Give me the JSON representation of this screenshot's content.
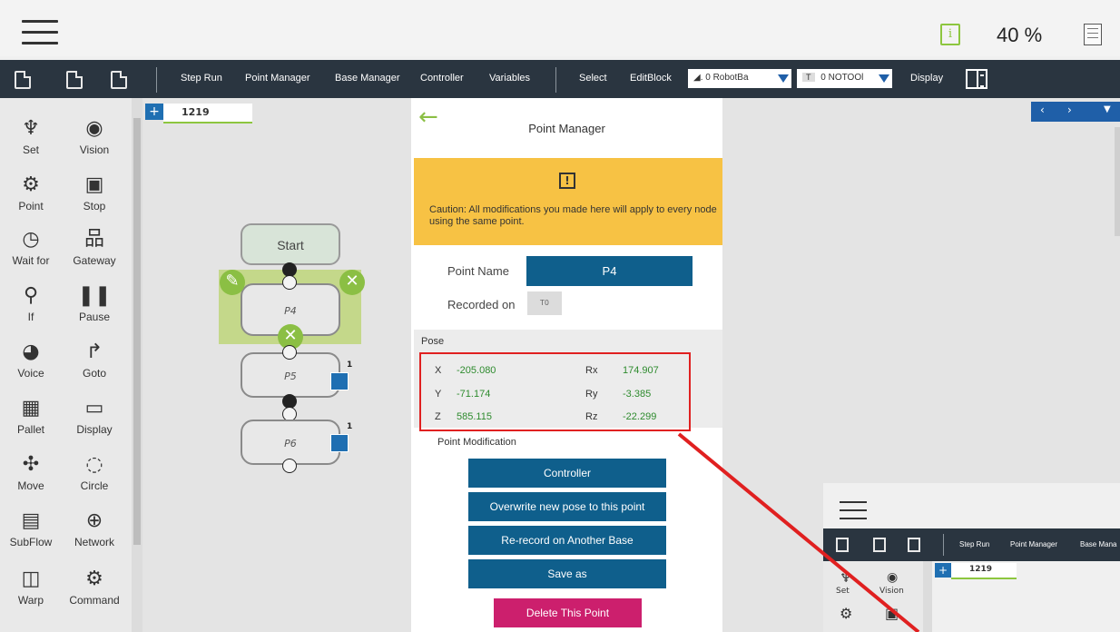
{
  "topbar": {
    "zoom": "40 %"
  },
  "toolbar": {
    "items": [
      "Step Run",
      "Point Manager",
      "Base Manager",
      "Controller",
      "Variables",
      "Select",
      "EditBlock",
      "Display"
    ],
    "base_select": "0 RobotBa",
    "tool_select": "0 NOTOOl",
    "tool_tag": "T"
  },
  "left_panel": [
    {
      "label": "Set",
      "icon": "wrench-icon"
    },
    {
      "label": "Vision",
      "icon": "eye-icon"
    },
    {
      "label": "Point",
      "icon": "robot-arm-icon"
    },
    {
      "label": "Stop",
      "icon": "stop-icon"
    },
    {
      "label": "Wait for",
      "icon": "clock-icon"
    },
    {
      "label": "Gateway",
      "icon": "gateway-icon"
    },
    {
      "label": "If",
      "icon": "branch-icon"
    },
    {
      "label": "Pause",
      "icon": "pause-icon"
    },
    {
      "label": "Voice",
      "icon": "voice-icon"
    },
    {
      "label": "Goto",
      "icon": "goto-arrow-icon"
    },
    {
      "label": "Pallet",
      "icon": "pallet-grid-icon"
    },
    {
      "label": "Display",
      "icon": "display-icon"
    },
    {
      "label": "Move",
      "icon": "move-icon"
    },
    {
      "label": "Circle",
      "icon": "circle-icon"
    },
    {
      "label": "SubFlow",
      "icon": "subflow-icon"
    },
    {
      "label": "Network",
      "icon": "globe-icon"
    },
    {
      "label": "Warp",
      "icon": "warp-icon"
    },
    {
      "label": "Command",
      "icon": "command-icon"
    }
  ],
  "flow": {
    "tab": "1219",
    "start": "Start",
    "nodes": [
      "P4",
      "P5",
      "P6"
    ],
    "badge_num": "1"
  },
  "point_manager": {
    "title": "Point Manager",
    "caution": "Caution: All modifications you made here will apply to every node using the same point.",
    "point_name_label": "Point Name",
    "point_name": "P4",
    "recorded_on_label": "Recorded on",
    "recorded_on": "T0",
    "pose_label": "Pose",
    "pose": {
      "x_label": "X",
      "x": "-205.080",
      "y_label": "Y",
      "y": "-71.174",
      "z_label": "Z",
      "z": "585.115",
      "rx_label": "Rx",
      "rx": "174.907",
      "ry_label": "Ry",
      "ry": "-3.385",
      "rz_label": "Rz",
      "rz": "-22.299"
    },
    "modification_label": "Point Modification",
    "buttons": [
      "Controller",
      "Overwrite new pose to this point",
      "Re-record on Another Base",
      "Save as"
    ],
    "delete": "Delete This Point"
  },
  "inset": {
    "items": [
      "Step Run",
      "Point Manager",
      "Base Mana"
    ],
    "tab": "1219",
    "left": [
      "Set",
      "Vision"
    ]
  },
  "colors": {
    "accent_green": "#8bbf44",
    "primary_blue": "#0f5f8c",
    "delete_pink": "#cc1f6d",
    "caution_yellow": "#f7c244",
    "highlight_red": "#e02020"
  }
}
